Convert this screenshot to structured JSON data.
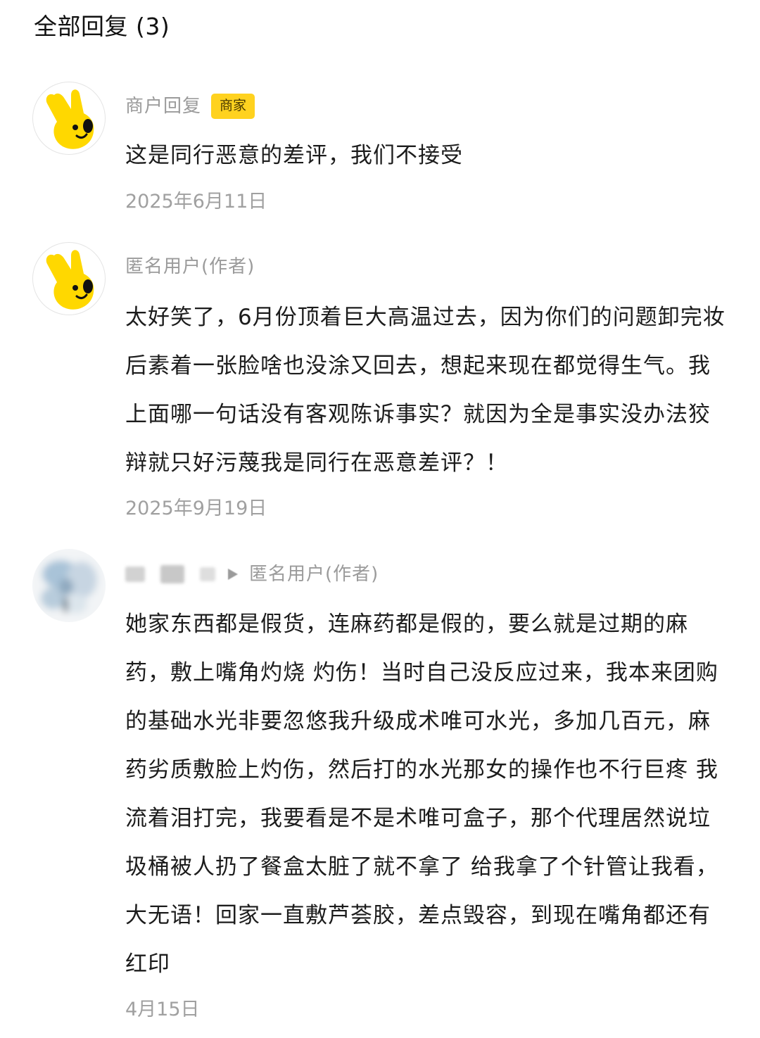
{
  "header": {
    "title": "全部回复 (3)"
  },
  "replies": [
    {
      "name": "商户回复",
      "badge": "商家",
      "avatar_icon": "yellow-mascot-hand-icon",
      "content": "这是同行恶意的差评，我们不接受",
      "date": "2025年6月11日"
    },
    {
      "name": "匿名用户(作者)",
      "avatar_icon": "yellow-mascot-hand-icon",
      "content": "太好笑了，6月份顶着巨大高温过去，因为你们的问题卸完妆后素着一张脸啥也没涂又回去，想起来现在都觉得生气。我上面哪一句话没有客观陈诉事实？就因为全是事实没办法狡辩就只好污蔑我是同行在恶意差评？！",
      "date": "2025年9月19日"
    },
    {
      "name": "匿名用户(作者)",
      "avatar_icon": "blurred-avatar-icon",
      "reply_arrow_icon": "reply-arrow-icon",
      "content": "她家东西都是假货，连麻药都是假的，要么就是过期的麻药，敷上嘴角灼烧 灼伤！当时自己没反应过来，我本来团购的基础水光非要忽悠我升级成术唯可水光，多加几百元，麻药劣质敷脸上灼伤，然后打的水光那女的操作也不行巨疼 我流着泪打完，我要看是不是术唯可盒子，那个代理居然说垃圾桶被人扔了餐盒太脏了就不拿了 给我拿了个针管让我看，大无语！回家一直敷芦荟胶，差点毁容，到现在嘴角都还有红印",
      "date": "4月15日"
    }
  ],
  "colors": {
    "badge_bg": "#ffd21f",
    "meta_text": "#9b9b9b",
    "body_text": "#1c1c1c",
    "mascot_yellow": "#ffd800"
  }
}
